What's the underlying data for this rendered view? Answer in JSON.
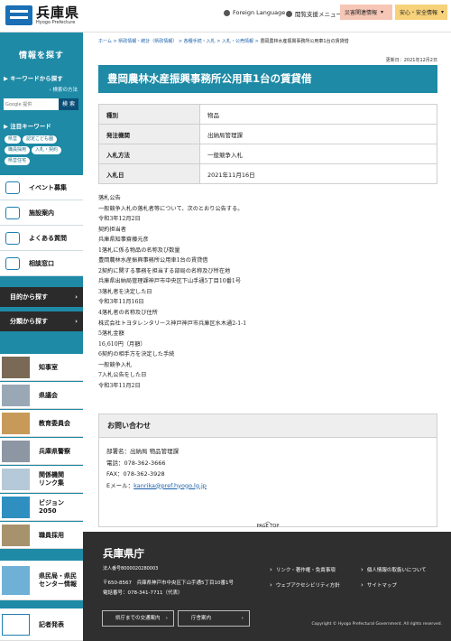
{
  "header": {
    "logo_jp": "兵庫県",
    "logo_en": "Hyogo Prefecture",
    "foreign_language": "Foreign Language",
    "reading_support": "閲覧支援メニュー",
    "disaster_btn": "災害関連情報",
    "safety_btn": "安心・安全情報",
    "colors": {
      "disaster": "#f6c6b6",
      "safety": "#f7d27a"
    }
  },
  "sidebar": {
    "title": "情報を探す",
    "keyword_label": "キーワードから探す",
    "search_help": "検索の方法",
    "search_placeholder": "Google 提供",
    "search_button": "検 索",
    "popular_label": "注目キーワード",
    "chips": [
      "県営",
      "認定こども園",
      "職員採用",
      "入札・契約",
      "県営住宅"
    ],
    "menu": [
      "イベント募集",
      "施設案内",
      "よくある質問",
      "相談窓口"
    ],
    "purpose_btn": "目的から探す",
    "category_btn": "分類から探す",
    "pic_items": [
      "知事室",
      "県議会",
      "教育委員会",
      "兵庫県警察",
      "関係機関\nリンク集",
      "ビジョン\n2050",
      "職員採用",
      "県民局・県民\nセンター情報",
      "記者発表"
    ],
    "accent": "#1e8aa6"
  },
  "breadcrumb": {
    "items": [
      "ホーム",
      "県政情報・統計（県政情報）",
      "各種手続・入札",
      "入札・公売情報"
    ],
    "current": "豊岡農林水産振興事務所公用車1台の賃貸借"
  },
  "updated": "更新日：2021年12月2日",
  "page_title": "豊岡農林水産振興事務所公用車1台の賃貸借",
  "info_table": [
    {
      "label": "種別",
      "value": "物品"
    },
    {
      "label": "発注機関",
      "value": "出納局管理課"
    },
    {
      "label": "入札方法",
      "value": "一般競争入札"
    },
    {
      "label": "入札日",
      "value": "2021年11月16日"
    }
  ],
  "notice_lines": [
    "落札公告",
    "一般競争入札の落札者等について、次のとおり公告する。",
    "令和3年12月2日",
    "契約担当者",
    "兵庫県知事齋藤元彦",
    "1落札に係る物品の名称及び数量",
    "豊岡農林水産振興事務所公用車1台の賃貸借",
    "2契約に関する事務を担当する部局の名称及び所在地",
    "兵庫県出納局管理課神戸市中央区下山手通5丁目10番1号",
    "3落札者を決定した日",
    "令和3年11月16日",
    "4落札者の名称及び住所",
    "株式会社トヨタレンタリース神戸神戸市兵庫区水木通2-1-1",
    "5落札金額",
    "16,610円（月額）",
    "6契約の相手方を決定した手続",
    "一般競争入札",
    "7入札公告をした日",
    "令和3年11月2日"
  ],
  "contact": {
    "heading": "お問い合わせ",
    "dept": "部署名：出納局 物品管理課",
    "tel": "電話：078-362-3666",
    "fax": "FAX：078-362-3928",
    "email_label": "Eメール：",
    "email": "kanrika@pref.hyogo.lg.jp"
  },
  "page_top": "PAGE TOP",
  "footer": {
    "name": "兵庫県庁",
    "code": "法人番号8000020280003",
    "address": "〒650-8567　兵庫県神戸市中央区下山手通5丁目10番1号",
    "phone": "電話番号：078-341-7711（代表）",
    "links": [
      "リンク・著作権・免責事項",
      "個人情報の取扱いについて",
      "ウェブアクセシビリティ方針",
      "サイトマップ"
    ],
    "transport_btn": "県庁までの交通案内",
    "building_btn": "庁舎案内",
    "copyright": "Copyright © Hyogo Prefectural Government. All rights reserved."
  }
}
